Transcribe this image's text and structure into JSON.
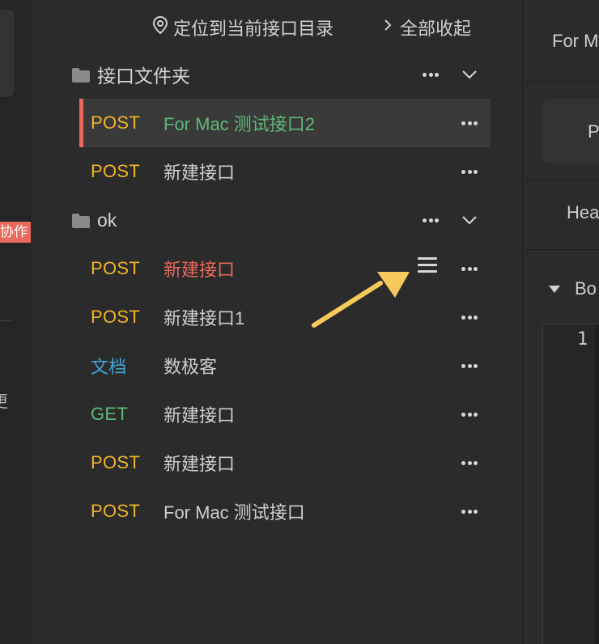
{
  "colors": {
    "post": "#f0b429",
    "get": "#5fb878",
    "doc": "#3fa7d6",
    "active_name": "#5fb878",
    "hover_name": "#e9695c",
    "accent": "#e9695c",
    "arrow": "#f7c95a"
  },
  "left": {
    "badge": "协作",
    "char": "更"
  },
  "toolbar": {
    "locate_label": "定位到当前接口目录",
    "collapse_label": "全部收起"
  },
  "folders": [
    {
      "name": "接口文件夹",
      "items": [
        {
          "method": "POST",
          "method_type": "post",
          "name": "For Mac 测试接口2",
          "state": "active"
        },
        {
          "method": "POST",
          "method_type": "post",
          "name": "新建接口",
          "state": "normal"
        }
      ]
    },
    {
      "name": "ok",
      "items": [
        {
          "method": "POST",
          "method_type": "post",
          "name": "新建接口",
          "state": "hover"
        },
        {
          "method": "POST",
          "method_type": "post",
          "name": "新建接口1",
          "state": "normal"
        },
        {
          "method": "文档",
          "method_type": "doc",
          "name": "数极客",
          "state": "normal"
        },
        {
          "method": "GET",
          "method_type": "get",
          "name": "新建接口",
          "state": "normal"
        },
        {
          "method": "POST",
          "method_type": "post",
          "name": "新建接口",
          "state": "normal"
        },
        {
          "method": "POST",
          "method_type": "post",
          "name": "For Mac 测试接口",
          "state": "normal"
        }
      ]
    }
  ],
  "right": {
    "tab_title": "For M",
    "method_label": "P",
    "headers_label": "Hea",
    "body_label": "Bo",
    "editor_line": "1"
  }
}
